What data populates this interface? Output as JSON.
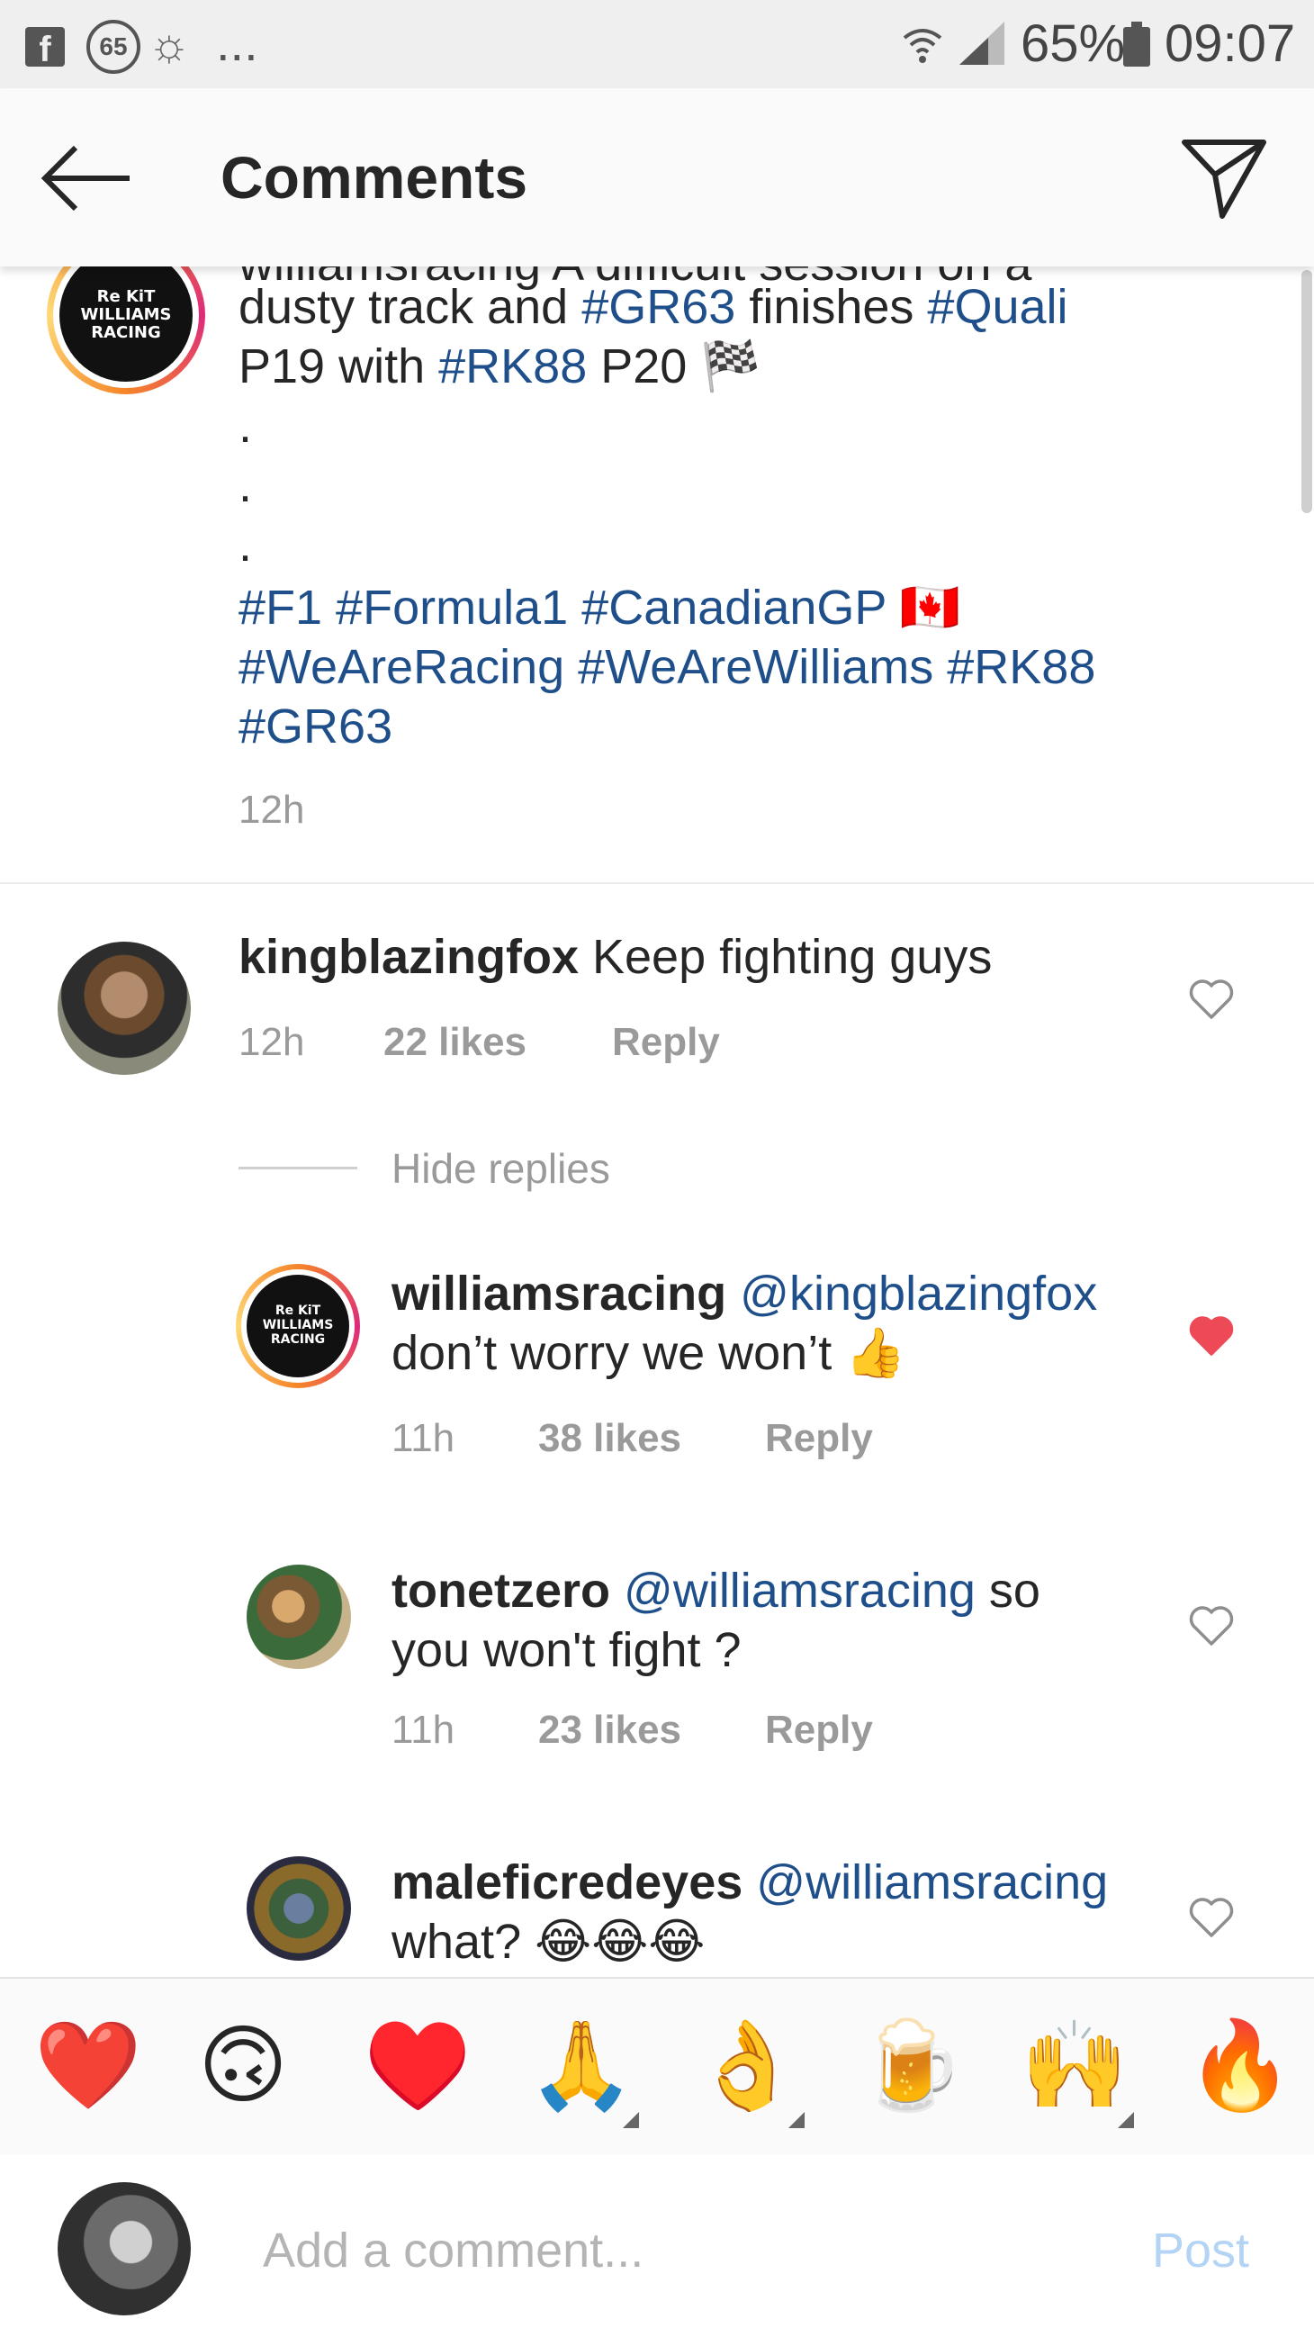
{
  "status_bar": {
    "fb_icon": "f",
    "badge": "65",
    "dots": "...",
    "battery": "65%",
    "time": "09:07"
  },
  "header": {
    "title": "Comments"
  },
  "caption": {
    "avatar_text": "ReKiT\nWILLIAMS\nRACING",
    "line0": "williamsracing A difficult session on a",
    "line1_a": "dusty track and ",
    "line1_tag1": "#GR63",
    "line1_b": " finishes ",
    "line1_tag2": "#Quali",
    "line2_a": "P19 with ",
    "line2_tag": "#RK88",
    "line2_b": " P20 🏁",
    "dot": ".",
    "tags_line1_a": "#F1 #Formula1 #CanadianGP",
    "tags_line1_flag": " 🇨🇦",
    "tags_line2": "#WeAreRacing #WeAreWilliams #RK88",
    "tags_line3": "#GR63",
    "time": "12h"
  },
  "comments": [
    {
      "username": "kingblazingfox",
      "text": " Keep fighting guys",
      "time": "12h",
      "likes": "22 likes",
      "reply": "Reply",
      "liked": false
    }
  ],
  "hide_replies": "Hide replies",
  "replies": [
    {
      "username": "williamsracing",
      "mention": " @kingblazingfox",
      "text_line2": "don’t worry we won’t 👍",
      "time": "11h",
      "likes": "38 likes",
      "reply": "Reply",
      "liked": true,
      "avatar_text": "ReKiT\nWILLIAMS\nRACING"
    },
    {
      "username": "tonetzero",
      "mention": " @williamsracing",
      "text_line1_tail": " so",
      "text_line2": "you won't fight ?",
      "time": "11h",
      "likes": "23 likes",
      "reply": "Reply",
      "liked": false
    },
    {
      "username": "maleficredeyes",
      "mention": " @williamsracing",
      "text_line2": "what? 😂😂😂",
      "liked": false
    }
  ],
  "emoji_bar": [
    "❤️",
    "🙃",
    "♥️",
    "🙏",
    "👌",
    "🍺",
    "🙌",
    "🔥"
  ],
  "comment_bar": {
    "placeholder": "Add a comment...",
    "post": "Post"
  },
  "colors": {
    "hashtag": "#1f4f8a",
    "liked_heart": "#ed4956",
    "post_disabled": "#b3d4f5"
  }
}
